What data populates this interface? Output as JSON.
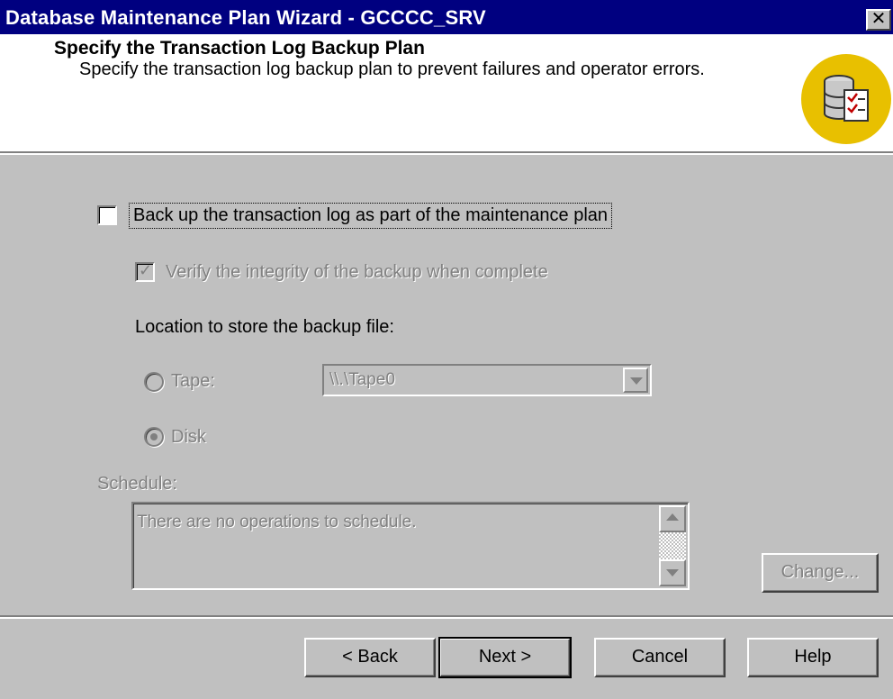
{
  "window": {
    "title": "Database Maintenance Plan Wizard - GCCCC_SRV",
    "close_glyph": "✕"
  },
  "header": {
    "title": "Specify the Transaction Log Backup Plan",
    "subtitle": "Specify the transaction log backup plan to prevent failures and operator errors.",
    "icon": "database-checklist-icon"
  },
  "backup": {
    "main_checkbox": {
      "label": "Back up the transaction log as part of the maintenance plan",
      "checked": false
    },
    "verify_checkbox": {
      "label": "Verify the integrity of the backup when complete",
      "checked": true,
      "disabled": true
    },
    "location_label": "Location to store the backup file:",
    "tape": {
      "label": "Tape:",
      "selected": false,
      "device": "\\\\.\\Tape0"
    },
    "disk": {
      "label": "Disk",
      "selected": true
    }
  },
  "schedule": {
    "label": "Schedule:",
    "text": "There are no operations to schedule.",
    "change_button": "Change..."
  },
  "footer": {
    "back": "< Back",
    "next": "Next >",
    "cancel": "Cancel",
    "help": "Help"
  },
  "colors": {
    "titlebar": "#000080",
    "face": "#c0c0c0",
    "disabled_text": "#808080",
    "icon_badge": "#e8c000"
  }
}
